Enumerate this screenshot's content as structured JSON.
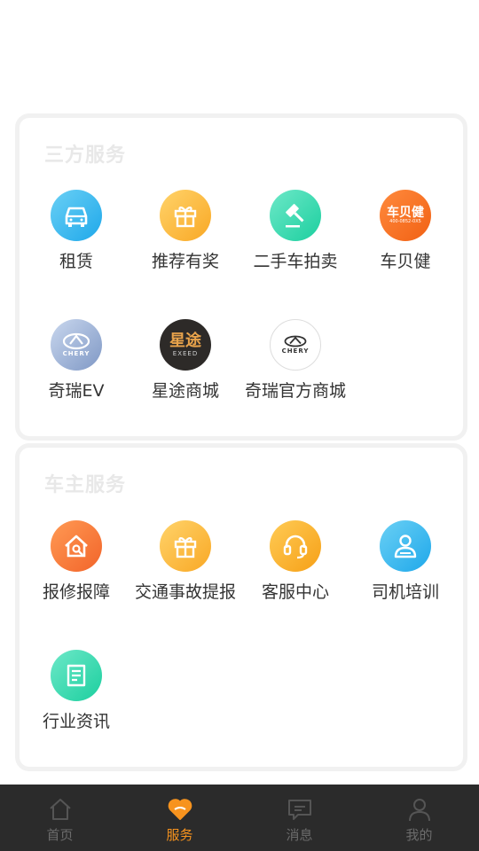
{
  "sections": [
    {
      "title": "三方服务",
      "items": [
        {
          "label": "租赁",
          "icon": "car-icon"
        },
        {
          "label": "推荐有奖",
          "icon": "gift-icon"
        },
        {
          "label": "二手车拍卖",
          "icon": "gavel-icon"
        },
        {
          "label": "车贝健",
          "icon": "chebeijian-logo-icon",
          "logo_text": "车贝健",
          "logo_sub": "400-0852-0X5"
        },
        {
          "label": "奇瑞EV",
          "icon": "chery-ev-logo-icon",
          "logo_text": "CHERY"
        },
        {
          "label": "星途商城",
          "icon": "exeed-logo-icon",
          "logo_text": "星途",
          "logo_sub": "EXEED"
        },
        {
          "label": "奇瑞官方商城",
          "icon": "chery-logo-icon",
          "logo_text": "CHERY"
        }
      ]
    },
    {
      "title": "车主服务",
      "items": [
        {
          "label": "报修报障",
          "icon": "repair-house-icon"
        },
        {
          "label": "交通事故提报",
          "icon": "gift-icon"
        },
        {
          "label": "客服中心",
          "icon": "headset-icon"
        },
        {
          "label": "司机培训",
          "icon": "driver-icon"
        },
        {
          "label": "行业资讯",
          "icon": "news-doc-icon"
        }
      ]
    }
  ],
  "tabbar": [
    {
      "label": "首页",
      "icon": "home-icon",
      "active": false
    },
    {
      "label": "服务",
      "icon": "heart-icon",
      "active": true
    },
    {
      "label": "消息",
      "icon": "message-icon",
      "active": false
    },
    {
      "label": "我的",
      "icon": "user-icon",
      "active": false
    }
  ],
  "colors": {
    "accent": "#f7931e",
    "tabbar_bg": "#2b2b2b",
    "tab_inactive": "#6b6b6b"
  }
}
